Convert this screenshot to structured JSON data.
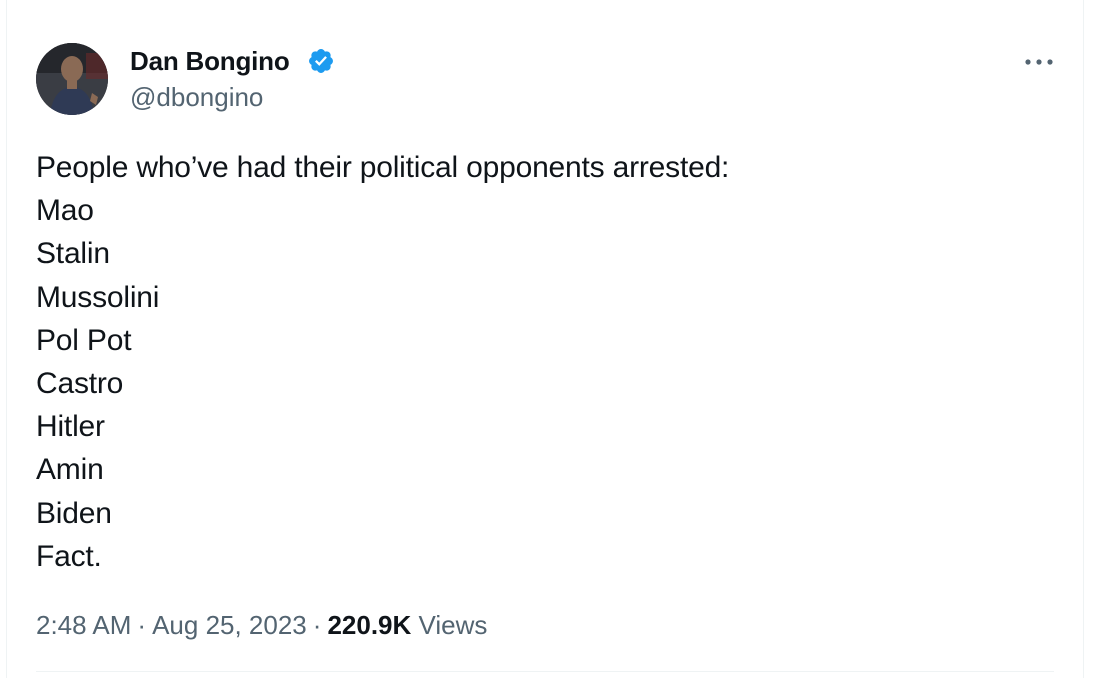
{
  "author": {
    "display_name": "Dan Bongino",
    "handle": "@dbongino",
    "verified": true,
    "verified_icon": "verified-badge-icon",
    "avatar_icon": "profile-photo"
  },
  "tweet": {
    "lines": [
      "People who’ve had their political opponents arrested:",
      "Mao",
      "Stalin",
      "Mussolini",
      "Pol Pot",
      "Castro",
      "Hitler",
      "Amin",
      "Biden",
      "Fact."
    ]
  },
  "meta": {
    "time": "2:48 AM",
    "date": "Aug 25, 2023",
    "separator": "·",
    "views_count": "220.9K",
    "views_label": "Views"
  },
  "colors": {
    "text_primary": "#0f1419",
    "text_secondary": "#536471",
    "verified_blue": "#1d9bf0",
    "border": "#eff3f4"
  }
}
